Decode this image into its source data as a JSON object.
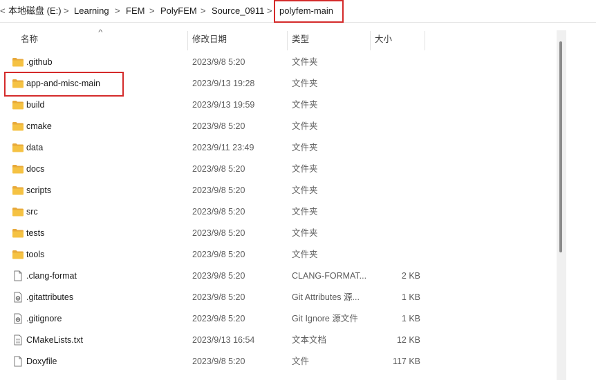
{
  "breadcrumb": {
    "items": [
      "本地磁盘 (E:)",
      "Learning",
      "FEM",
      "PolyFEM",
      "Source_0911",
      "polyfem-main"
    ],
    "separator": ">",
    "back_chevron": "<"
  },
  "columns": {
    "name": "名称",
    "date": "修改日期",
    "type": "类型",
    "size": "大小"
  },
  "sort_indicator": "^",
  "files": [
    {
      "name": ".github",
      "date": "2023/9/8 5:20",
      "type": "文件夹",
      "size": "",
      "icon": "folder-icon"
    },
    {
      "name": "app-and-misc-main",
      "date": "2023/9/13 19:28",
      "type": "文件夹",
      "size": "",
      "icon": "folder-icon"
    },
    {
      "name": "build",
      "date": "2023/9/13 19:59",
      "type": "文件夹",
      "size": "",
      "icon": "folder-icon"
    },
    {
      "name": "cmake",
      "date": "2023/9/8 5:20",
      "type": "文件夹",
      "size": "",
      "icon": "folder-icon"
    },
    {
      "name": "data",
      "date": "2023/9/11 23:49",
      "type": "文件夹",
      "size": "",
      "icon": "folder-icon"
    },
    {
      "name": "docs",
      "date": "2023/9/8 5:20",
      "type": "文件夹",
      "size": "",
      "icon": "folder-icon"
    },
    {
      "name": "scripts",
      "date": "2023/9/8 5:20",
      "type": "文件夹",
      "size": "",
      "icon": "folder-icon"
    },
    {
      "name": "src",
      "date": "2023/9/8 5:20",
      "type": "文件夹",
      "size": "",
      "icon": "folder-icon"
    },
    {
      "name": "tests",
      "date": "2023/9/8 5:20",
      "type": "文件夹",
      "size": "",
      "icon": "folder-icon"
    },
    {
      "name": "tools",
      "date": "2023/9/8 5:20",
      "type": "文件夹",
      "size": "",
      "icon": "folder-icon"
    },
    {
      "name": ".clang-format",
      "date": "2023/9/8 5:20",
      "type": "CLANG-FORMAT...",
      "size": "2 KB",
      "icon": "blank-file-icon"
    },
    {
      "name": ".gitattributes",
      "date": "2023/9/8 5:20",
      "type": "Git Attributes 源...",
      "size": "1 KB",
      "icon": "settings-file-icon"
    },
    {
      "name": ".gitignore",
      "date": "2023/9/8 5:20",
      "type": "Git Ignore 源文件",
      "size": "1 KB",
      "icon": "settings-file-icon"
    },
    {
      "name": "CMakeLists.txt",
      "date": "2023/9/13 16:54",
      "type": "文本文档",
      "size": "12 KB",
      "icon": "text-file-icon"
    },
    {
      "name": "Doxyfile",
      "date": "2023/9/8 5:20",
      "type": "文件",
      "size": "117 KB",
      "icon": "blank-file-icon"
    }
  ],
  "colors": {
    "folder": "#f5c243",
    "highlight": "#d42a2a"
  }
}
